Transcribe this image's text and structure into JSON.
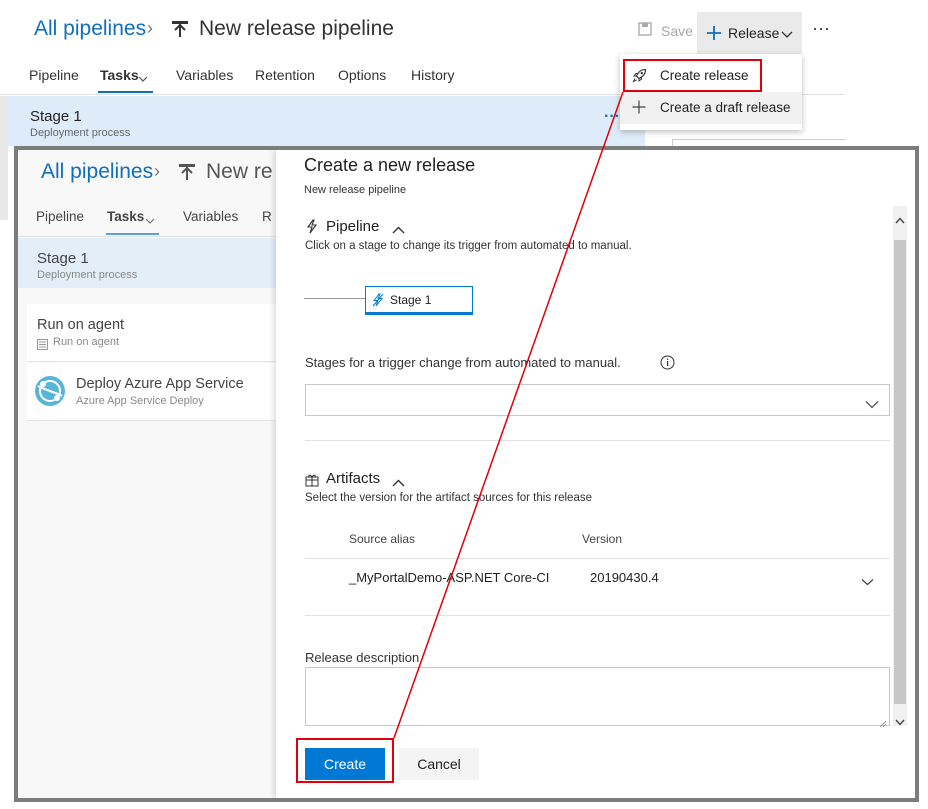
{
  "background": {
    "breadcrumb": {
      "link": "All pipelines",
      "title": "New release pipeline"
    },
    "toolbar": {
      "save_label": "Save",
      "release_label": "Release",
      "more_label": "···"
    },
    "tabs": [
      {
        "label": "Pipeline"
      },
      {
        "label": "Tasks"
      },
      {
        "label": "Variables"
      },
      {
        "label": "Retention"
      },
      {
        "label": "Options"
      },
      {
        "label": "History"
      }
    ],
    "stage": {
      "name": "Stage 1",
      "subtitle": "Deployment process",
      "ellipsis": "···"
    }
  },
  "release_menu": {
    "items": [
      {
        "label": "Create release"
      },
      {
        "label": "Create a draft release"
      }
    ]
  },
  "inner": {
    "breadcrumb": {
      "link": "All pipelines",
      "title": "New re"
    },
    "tabs": [
      {
        "label": "Pipeline"
      },
      {
        "label": "Tasks"
      },
      {
        "label": "Variables"
      },
      {
        "label": "R"
      }
    ],
    "stage": {
      "name": "Stage 1",
      "subtitle": "Deployment process"
    },
    "job": {
      "name": "Run on agent",
      "subtitle": "Run on agent"
    },
    "task": {
      "name": "Deploy Azure App Service",
      "subtitle": "Azure App Service Deploy"
    }
  },
  "dialog": {
    "title": "Create a new release",
    "subtitle": "New release pipeline",
    "pipeline_section": {
      "title": "Pipeline",
      "description": "Click on a stage to change its trigger from automated to manual.",
      "stage_label": "Stage 1"
    },
    "trigger_field": {
      "label": "Stages for a trigger change from automated to manual.",
      "value": ""
    },
    "artifacts_section": {
      "title": "Artifacts",
      "description": "Select the version for the artifact sources for this release",
      "columns": [
        "Source alias",
        "Version"
      ],
      "rows": [
        {
          "source_alias": "_MyPortalDemo-ASP.NET Core-CI",
          "version": "20190430.4"
        }
      ]
    },
    "description_field": {
      "label": "Release description",
      "value": ""
    },
    "buttons": {
      "create": "Create",
      "cancel": "Cancel"
    }
  },
  "colors": {
    "accent": "#0078d4",
    "link": "#106ebe",
    "highlight_box": "#e0000b",
    "stage_bar": "#deecf9"
  },
  "icons": [
    "pipeline-icon",
    "save-icon",
    "plus-icon",
    "chevron-down-icon",
    "rocket-icon",
    "lightning-icon",
    "info-icon",
    "gift-icon",
    "chevron-up-icon",
    "agent-icon",
    "azure-app-service-icon",
    "scroll-up-icon",
    "scroll-down-icon",
    "resize-grip-icon"
  ]
}
